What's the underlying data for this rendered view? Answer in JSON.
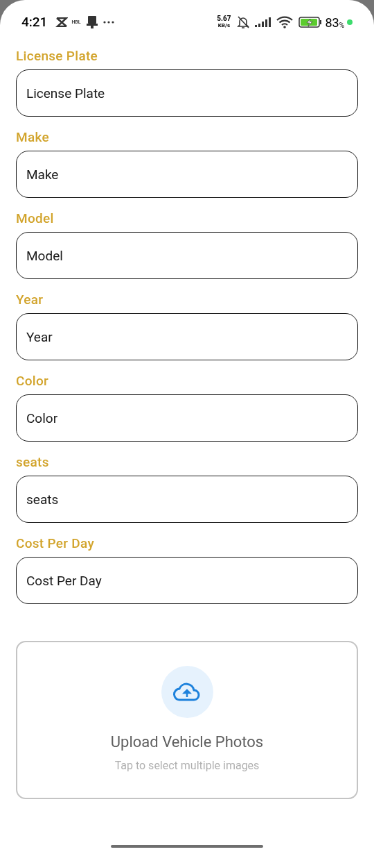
{
  "status_bar": {
    "time": "4:21",
    "app_label": "HBL",
    "speed_value": "5.67",
    "speed_unit": "KB/s",
    "battery": "83",
    "battery_unit": "%"
  },
  "fields": [
    {
      "label": "License Plate",
      "placeholder": "License Plate"
    },
    {
      "label": "Make",
      "placeholder": "Make"
    },
    {
      "label": "Model",
      "placeholder": "Model"
    },
    {
      "label": "Year",
      "placeholder": "Year"
    },
    {
      "label": "Color",
      "placeholder": "Color"
    },
    {
      "label": "seats",
      "placeholder": "seats"
    },
    {
      "label": "Cost Per Day",
      "placeholder": "Cost Per Day"
    }
  ],
  "upload": {
    "title": "Upload Vehicle Photos",
    "subtitle": "Tap to select multiple images"
  }
}
